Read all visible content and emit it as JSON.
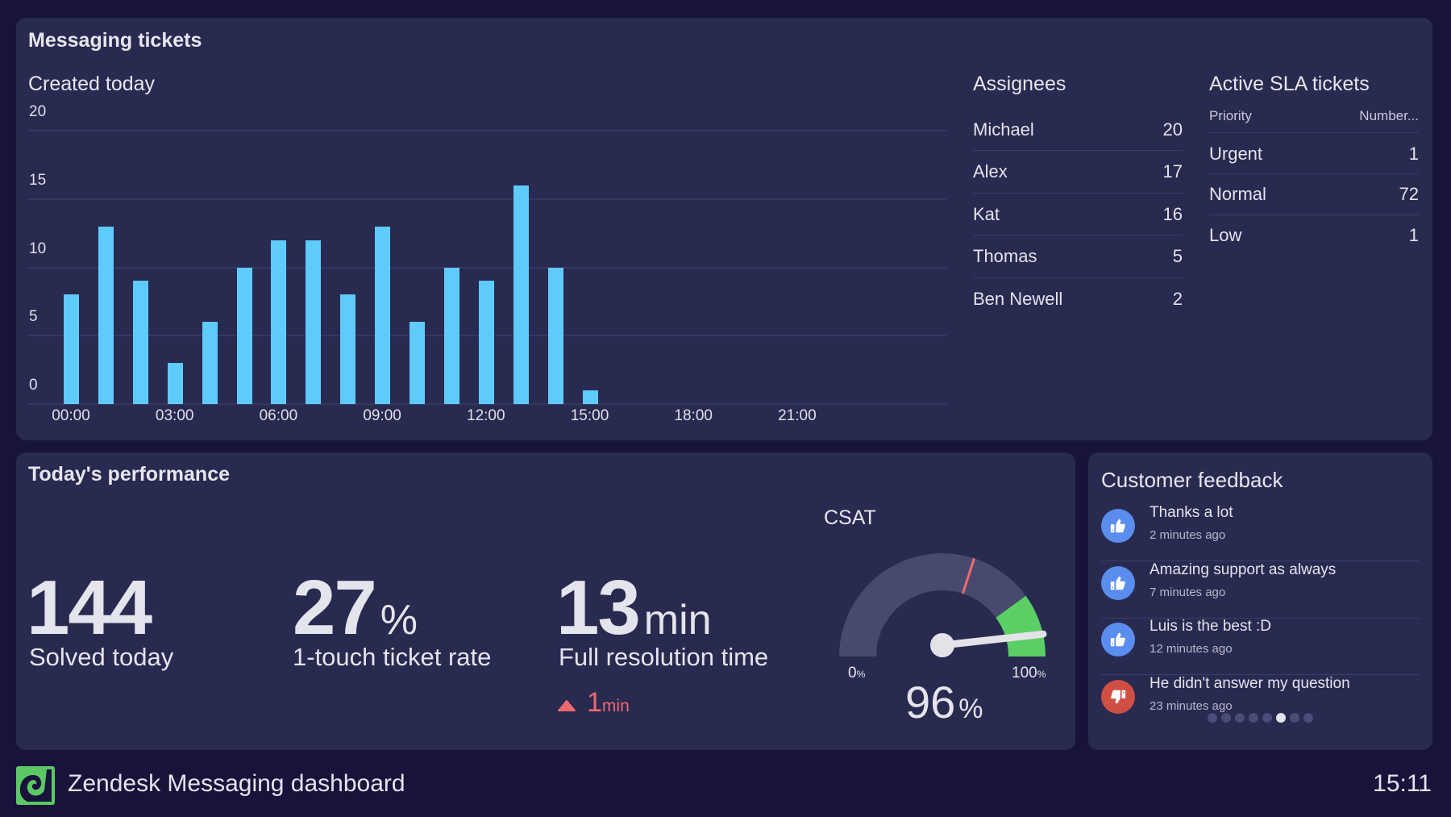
{
  "colors": {
    "background": "#17133b",
    "panel": "#282a50",
    "bar": "#5ecbfb",
    "positive": "#5b8def",
    "negative": "#cf4f45",
    "gauge_track": "#474a6e",
    "gauge_good": "#5bcf65",
    "gauge_target": "#ef6a6f",
    "delta": "#ef6a6f",
    "brand": "#5bc865"
  },
  "tickets": {
    "title": "Messaging tickets",
    "created_title": "Created today",
    "assignees": {
      "title": "Assignees",
      "rows": [
        {
          "name": "Michael",
          "count": "20"
        },
        {
          "name": "Alex",
          "count": "17"
        },
        {
          "name": "Kat",
          "count": "16"
        },
        {
          "name": "Thomas",
          "count": "5"
        },
        {
          "name": "Ben Newell",
          "count": "2"
        }
      ]
    },
    "sla": {
      "title": "Active SLA tickets",
      "col_priority": "Priority",
      "col_number": "Number...",
      "rows": [
        {
          "priority": "Urgent",
          "count": "1"
        },
        {
          "priority": "Normal",
          "count": "72"
        },
        {
          "priority": "Low",
          "count": "1"
        }
      ]
    }
  },
  "chart_data": {
    "type": "bar",
    "title": "Created today",
    "xlabel": "",
    "ylabel": "",
    "x": [
      "00:00",
      "01:00",
      "02:00",
      "03:00",
      "04:00",
      "05:00",
      "06:00",
      "07:00",
      "08:00",
      "09:00",
      "10:00",
      "11:00",
      "12:00",
      "13:00",
      "14:00",
      "15:00",
      "16:00",
      "17:00",
      "18:00",
      "19:00",
      "20:00",
      "21:00",
      "22:00",
      "23:00"
    ],
    "values": [
      8,
      13,
      9,
      3,
      6,
      10,
      12,
      12,
      8,
      13,
      6,
      10,
      9,
      16,
      10,
      1,
      null,
      null,
      null,
      null,
      null,
      null,
      null,
      null
    ],
    "x_tick_labels": [
      "00:00",
      "03:00",
      "06:00",
      "09:00",
      "12:00",
      "15:00",
      "18:00",
      "21:00"
    ],
    "y_ticks": [
      0,
      5,
      10,
      15,
      20
    ],
    "ylim": [
      0,
      20
    ],
    "grid": true,
    "legend": "none"
  },
  "performance": {
    "title": "Today's performance",
    "solved": {
      "value": "144",
      "label": "Solved today"
    },
    "one_touch": {
      "value": "27",
      "unit": "%",
      "label": "1-touch ticket rate"
    },
    "resolution": {
      "value": "13",
      "unit": "min",
      "label": "Full resolution time",
      "delta_value": "1",
      "delta_unit": "min",
      "delta_direction": "up",
      "delta_icon": "triangle-up-icon"
    },
    "csat": {
      "title": "CSAT",
      "value": 96,
      "value_text": "96",
      "unit": "%",
      "min_label": "0",
      "max_label": "100",
      "label_unit": "%",
      "target": 60,
      "good_threshold": 80
    }
  },
  "feedback": {
    "title": "Customer feedback",
    "items": [
      {
        "text": "Thanks a lot",
        "time": "2 minutes ago",
        "sentiment": "positive",
        "icon": "thumbs-up-icon"
      },
      {
        "text": "Amazing support as always",
        "time": "7 minutes ago",
        "sentiment": "positive",
        "icon": "thumbs-up-icon"
      },
      {
        "text": "Luis is the best :D",
        "time": "12 minutes ago",
        "sentiment": "positive",
        "icon": "thumbs-up-icon"
      },
      {
        "text": "He didn't answer my question",
        "time": "23 minutes ago",
        "sentiment": "negative",
        "icon": "thumbs-down-icon"
      }
    ],
    "pager": {
      "total": 8,
      "active": 6
    }
  },
  "footer": {
    "title": "Zendesk Messaging dashboard",
    "clock": "15:11",
    "logo_icon": "zendesk-logo-icon"
  }
}
